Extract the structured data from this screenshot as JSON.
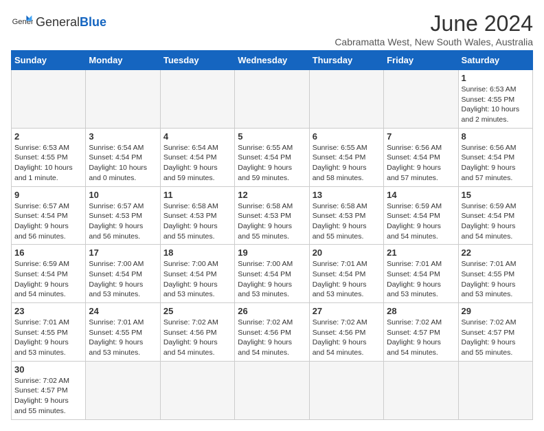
{
  "header": {
    "logo_general": "General",
    "logo_blue": "Blue",
    "month_title": "June 2024",
    "location": "Cabramatta West, New South Wales, Australia"
  },
  "days_of_week": [
    "Sunday",
    "Monday",
    "Tuesday",
    "Wednesday",
    "Thursday",
    "Friday",
    "Saturday"
  ],
  "weeks": [
    [
      {
        "day": "",
        "info": ""
      },
      {
        "day": "",
        "info": ""
      },
      {
        "day": "",
        "info": ""
      },
      {
        "day": "",
        "info": ""
      },
      {
        "day": "",
        "info": ""
      },
      {
        "day": "",
        "info": ""
      },
      {
        "day": "1",
        "info": "Sunrise: 6:53 AM\nSunset: 4:55 PM\nDaylight: 10 hours\nand 2 minutes."
      }
    ],
    [
      {
        "day": "2",
        "info": "Sunrise: 6:53 AM\nSunset: 4:55 PM\nDaylight: 10 hours\nand 1 minute."
      },
      {
        "day": "3",
        "info": "Sunrise: 6:54 AM\nSunset: 4:54 PM\nDaylight: 10 hours\nand 0 minutes."
      },
      {
        "day": "4",
        "info": "Sunrise: 6:54 AM\nSunset: 4:54 PM\nDaylight: 9 hours\nand 59 minutes."
      },
      {
        "day": "5",
        "info": "Sunrise: 6:55 AM\nSunset: 4:54 PM\nDaylight: 9 hours\nand 59 minutes."
      },
      {
        "day": "6",
        "info": "Sunrise: 6:55 AM\nSunset: 4:54 PM\nDaylight: 9 hours\nand 58 minutes."
      },
      {
        "day": "7",
        "info": "Sunrise: 6:56 AM\nSunset: 4:54 PM\nDaylight: 9 hours\nand 57 minutes."
      },
      {
        "day": "8",
        "info": "Sunrise: 6:56 AM\nSunset: 4:54 PM\nDaylight: 9 hours\nand 57 minutes."
      }
    ],
    [
      {
        "day": "9",
        "info": "Sunrise: 6:57 AM\nSunset: 4:54 PM\nDaylight: 9 hours\nand 56 minutes."
      },
      {
        "day": "10",
        "info": "Sunrise: 6:57 AM\nSunset: 4:53 PM\nDaylight: 9 hours\nand 56 minutes."
      },
      {
        "day": "11",
        "info": "Sunrise: 6:58 AM\nSunset: 4:53 PM\nDaylight: 9 hours\nand 55 minutes."
      },
      {
        "day": "12",
        "info": "Sunrise: 6:58 AM\nSunset: 4:53 PM\nDaylight: 9 hours\nand 55 minutes."
      },
      {
        "day": "13",
        "info": "Sunrise: 6:58 AM\nSunset: 4:53 PM\nDaylight: 9 hours\nand 55 minutes."
      },
      {
        "day": "14",
        "info": "Sunrise: 6:59 AM\nSunset: 4:54 PM\nDaylight: 9 hours\nand 54 minutes."
      },
      {
        "day": "15",
        "info": "Sunrise: 6:59 AM\nSunset: 4:54 PM\nDaylight: 9 hours\nand 54 minutes."
      }
    ],
    [
      {
        "day": "16",
        "info": "Sunrise: 6:59 AM\nSunset: 4:54 PM\nDaylight: 9 hours\nand 54 minutes."
      },
      {
        "day": "17",
        "info": "Sunrise: 7:00 AM\nSunset: 4:54 PM\nDaylight: 9 hours\nand 53 minutes."
      },
      {
        "day": "18",
        "info": "Sunrise: 7:00 AM\nSunset: 4:54 PM\nDaylight: 9 hours\nand 53 minutes."
      },
      {
        "day": "19",
        "info": "Sunrise: 7:00 AM\nSunset: 4:54 PM\nDaylight: 9 hours\nand 53 minutes."
      },
      {
        "day": "20",
        "info": "Sunrise: 7:01 AM\nSunset: 4:54 PM\nDaylight: 9 hours\nand 53 minutes."
      },
      {
        "day": "21",
        "info": "Sunrise: 7:01 AM\nSunset: 4:54 PM\nDaylight: 9 hours\nand 53 minutes."
      },
      {
        "day": "22",
        "info": "Sunrise: 7:01 AM\nSunset: 4:55 PM\nDaylight: 9 hours\nand 53 minutes."
      }
    ],
    [
      {
        "day": "23",
        "info": "Sunrise: 7:01 AM\nSunset: 4:55 PM\nDaylight: 9 hours\nand 53 minutes."
      },
      {
        "day": "24",
        "info": "Sunrise: 7:01 AM\nSunset: 4:55 PM\nDaylight: 9 hours\nand 53 minutes."
      },
      {
        "day": "25",
        "info": "Sunrise: 7:02 AM\nSunset: 4:56 PM\nDaylight: 9 hours\nand 54 minutes."
      },
      {
        "day": "26",
        "info": "Sunrise: 7:02 AM\nSunset: 4:56 PM\nDaylight: 9 hours\nand 54 minutes."
      },
      {
        "day": "27",
        "info": "Sunrise: 7:02 AM\nSunset: 4:56 PM\nDaylight: 9 hours\nand 54 minutes."
      },
      {
        "day": "28",
        "info": "Sunrise: 7:02 AM\nSunset: 4:57 PM\nDaylight: 9 hours\nand 54 minutes."
      },
      {
        "day": "29",
        "info": "Sunrise: 7:02 AM\nSunset: 4:57 PM\nDaylight: 9 hours\nand 55 minutes."
      }
    ],
    [
      {
        "day": "30",
        "info": "Sunrise: 7:02 AM\nSunset: 4:57 PM\nDaylight: 9 hours\nand 55 minutes."
      },
      {
        "day": "",
        "info": ""
      },
      {
        "day": "",
        "info": ""
      },
      {
        "day": "",
        "info": ""
      },
      {
        "day": "",
        "info": ""
      },
      {
        "day": "",
        "info": ""
      },
      {
        "day": "",
        "info": ""
      }
    ]
  ]
}
